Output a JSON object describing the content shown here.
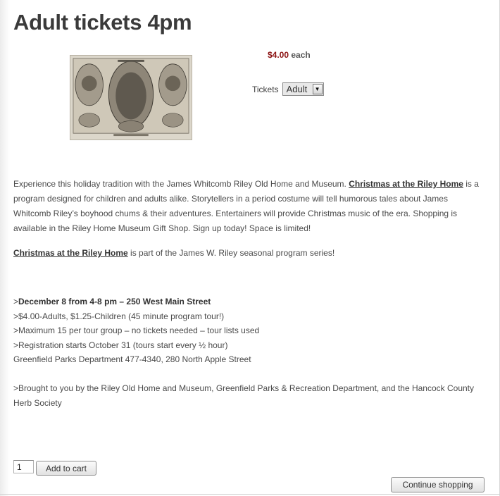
{
  "product": {
    "title": "Adult tickets 4pm",
    "price": "$4.00",
    "price_suffix": " each",
    "ticket_label": "Tickets",
    "ticket_selected": "Adult"
  },
  "description": {
    "p1_before": "Experience this holiday tradition with the James Whitcomb Riley Old Home and Museum. ",
    "p1_link": "Christmas at the Riley Home",
    "p1_after": " is a program designed for children and adults alike. Storytellers in a period costume will tell humorous tales about James Whitcomb Riley’s boyhood chums & their adventures. Entertainers will provide Christmas music of the era. Shopping is available in the Riley Home Museum Gift Shop. Sign up today! Space is limited!",
    "p2_link": "Christmas at the Riley Home",
    "p2_after": " is part of the James W. Riley seasonal program series!"
  },
  "details": {
    "line1_prefix": ">",
    "line1_bold": "December 8 from 4-8 pm – 250 West Main Street",
    "line2": ">$4.00-Adults, $1.25-Children (45 minute program tour!)",
    "line3": ">Maximum 15 per tour group – no tickets needed – tour lists used",
    "line4": ">Registration starts October 31 (tours start every ½ hour)",
    "line5": "Greenfield Parks Department 477-4340, 280 North Apple Street",
    "line6": ">Brought to you by the Riley Old Home and Museum, Greenfield Parks & Recreation Department, and the Hancock County Herb Society"
  },
  "cart": {
    "quantity": "1",
    "add_label": "Add to cart",
    "continue_label": "Continue shopping"
  },
  "colors": {
    "price": "#8b1111",
    "title": "#3a3a3a"
  }
}
